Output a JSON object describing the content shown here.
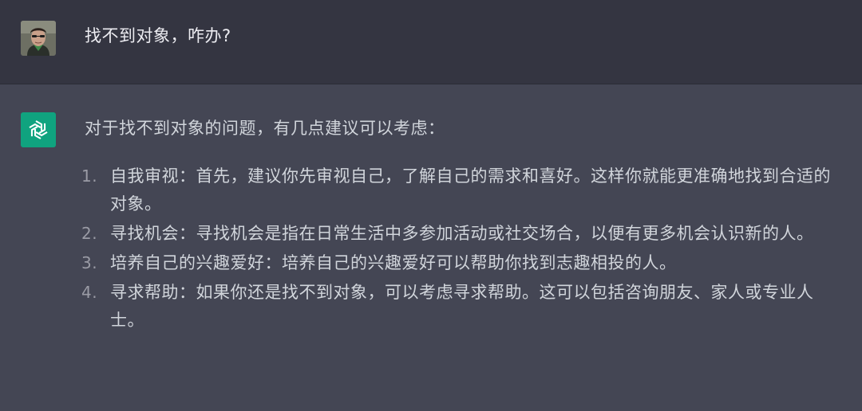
{
  "user_message": {
    "avatar_icon": "user-photo-avatar",
    "text": "找不到对象，咋办?"
  },
  "assistant_message": {
    "avatar_icon": "openai-logo-icon",
    "avatar_color": "#10a37f",
    "intro": "对于找不到对象的问题，有几点建议可以考虑：",
    "points": [
      {
        "number": "1.",
        "text": "自我审视：首先，建议你先审视自己，了解自己的需求和喜好。这样你就能更准确地找到合适的对象。"
      },
      {
        "number": "2.",
        "text": "寻找机会：寻找机会是指在日常生活中多参加活动或社交场合，以便有更多机会认识新的人。"
      },
      {
        "number": "3.",
        "text": "培养自己的兴趣爱好：培养自己的兴趣爱好可以帮助你找到志趣相投的人。"
      },
      {
        "number": "4.",
        "text": "寻求帮助：如果你还是找不到对象，可以考虑寻求帮助。这可以包括咨询朋友、家人或专业人士。"
      }
    ]
  }
}
